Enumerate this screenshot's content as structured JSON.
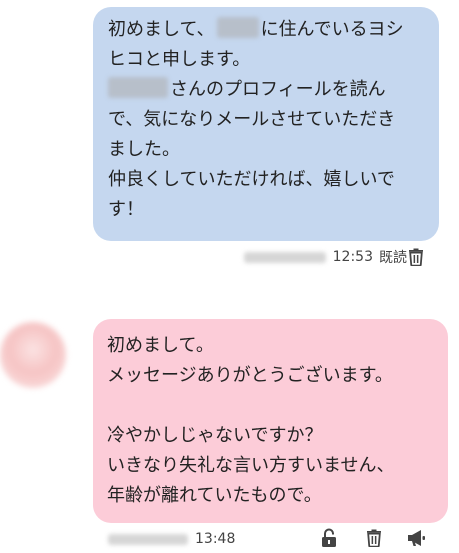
{
  "messages": {
    "outgoing": {
      "line1_pre": "初めまして、",
      "line1_post": "に住んでいるヨシ",
      "line2": "ヒコと申します。",
      "line3_post": "さんのプロフィールを読ん",
      "line4": "で、気になりメールさせていただき",
      "line5": "ました。",
      "line6": "仲良くしていただければ、嬉しいで",
      "line7": "す！",
      "time": "12:53",
      "read_status": "既読"
    },
    "incoming": {
      "line1": "初めまして。",
      "line2": "メッセージありがとうございます。",
      "line4": "冷やかしじゃないですか？",
      "line5": "いきなり失礼な言い方すいません、",
      "line6": "年齢が離れていたもので。",
      "time": "13:48"
    }
  },
  "icons": {
    "delete": "trash-icon",
    "unlock": "unlock-icon",
    "report": "megaphone-icon"
  },
  "colors": {
    "outgoing_bubble": "#c5d7ef",
    "incoming_bubble": "#fcccd8",
    "text": "#222222",
    "meta_text": "#444444"
  }
}
